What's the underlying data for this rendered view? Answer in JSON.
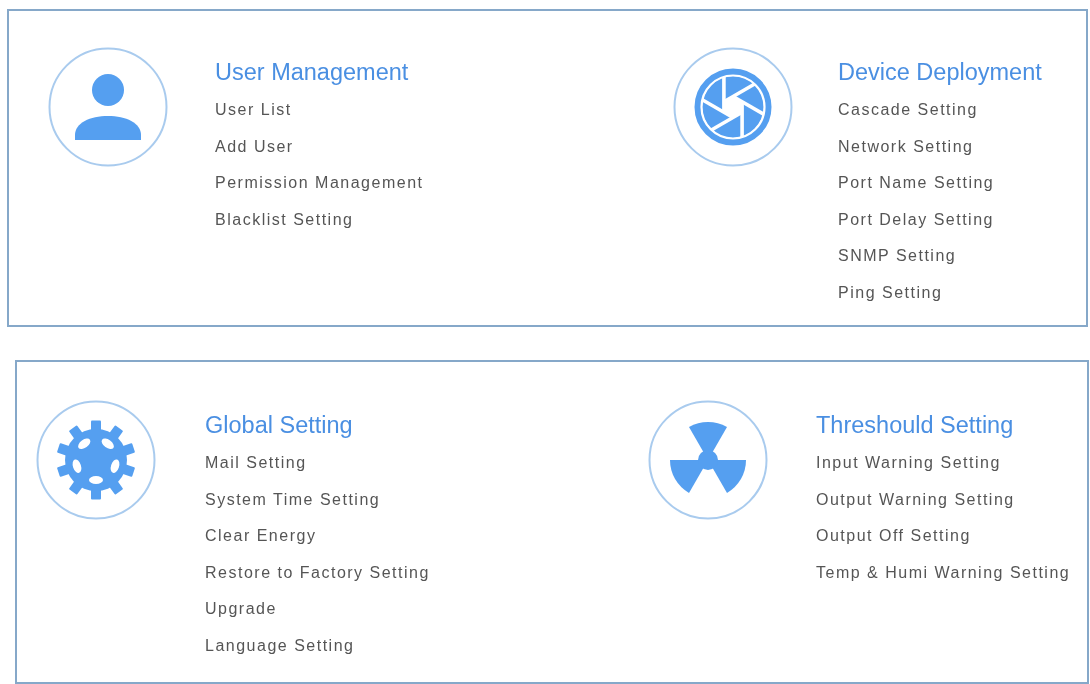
{
  "panels": [
    {
      "sections": [
        {
          "kind": "person",
          "title": "User Management",
          "items": [
            "User List",
            "Add User",
            "Permission Management",
            "Blacklist Setting"
          ]
        },
        {
          "kind": "aperture",
          "title": "Device Deployment",
          "items": [
            "Cascade Setting",
            "Network Setting",
            "Port Name Setting",
            "Port Delay Setting",
            "SNMP Setting",
            "Ping Setting"
          ]
        }
      ]
    },
    {
      "sections": [
        {
          "kind": "gear",
          "title": "Global Setting",
          "items": [
            "Mail Setting",
            "System Time Setting",
            "Clear Energy",
            "Restore to Factory Setting",
            "Upgrade",
            "Language Setting"
          ]
        },
        {
          "kind": "radiation",
          "title": "Threshould Setting",
          "items": [
            "Input Warning Setting",
            "Output Warning Setting",
            "Output Off Setting",
            "Temp & Humi Warning Setting"
          ]
        }
      ]
    }
  ]
}
